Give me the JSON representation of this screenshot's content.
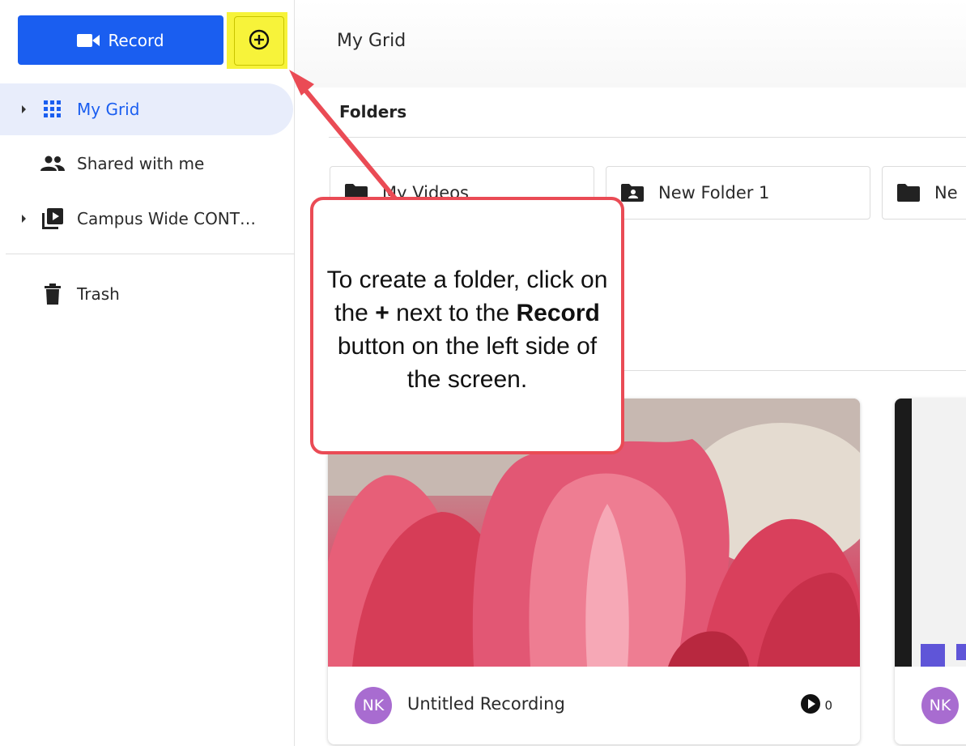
{
  "sidebar": {
    "record_label": "Record",
    "items": [
      {
        "label": "My Grid",
        "icon": "grid-icon",
        "active": true
      },
      {
        "label": "Shared with me",
        "icon": "people-icon"
      },
      {
        "label": "Campus Wide CONT…",
        "icon": "video-library-icon"
      },
      {
        "label": "Trash",
        "icon": "trash-icon"
      }
    ]
  },
  "main": {
    "breadcrumb": "My Grid",
    "folders_heading": "Folders",
    "folders": [
      {
        "label": "My Videos",
        "icon": "folder-icon"
      },
      {
        "label": "New Folder 1",
        "icon": "shared-folder-icon"
      },
      {
        "label": "Ne",
        "icon": "folder-icon"
      }
    ],
    "videos": [
      {
        "title": "Untitled Recording",
        "avatar": "NK",
        "views": "0"
      },
      {
        "title": "",
        "avatar": "NK",
        "views": ""
      }
    ]
  },
  "callout": {
    "line_a": "To create a folder, click on the",
    "plus": "+",
    "line_b": "next to the",
    "record": "Record",
    "line_c": "button on the left side of the screen."
  },
  "colors": {
    "accent": "#1a5ef0",
    "highlight": "#f7f33a",
    "callout_border": "#ea4b55",
    "avatar": "#a86cd0"
  }
}
